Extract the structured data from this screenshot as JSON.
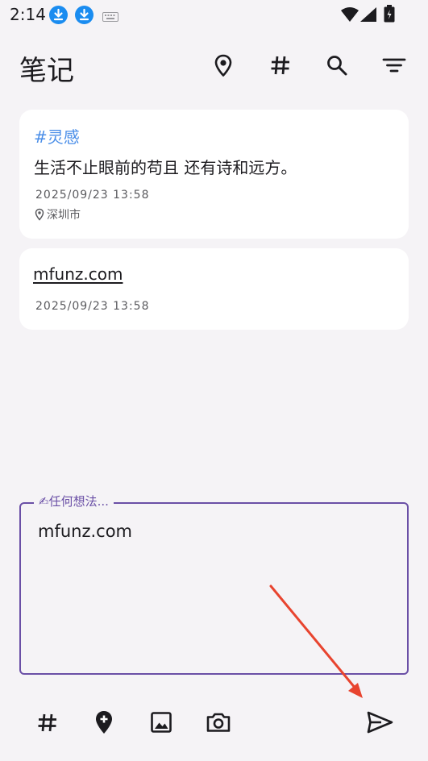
{
  "status_bar": {
    "time": "2:14",
    "icons": [
      "download-icon",
      "download-icon",
      "keyboard-icon",
      "wifi-icon",
      "signal-icon",
      "battery-icon"
    ]
  },
  "app_bar": {
    "title": "笔记",
    "actions": [
      "location-icon",
      "hashtag-icon",
      "search-icon",
      "filter-icon"
    ]
  },
  "notes": [
    {
      "tag": "#灵感",
      "text": "生活不止眼前的苟且 还有诗和远方。",
      "date": "2025/09/23 13:58",
      "location": "深圳市"
    },
    {
      "link": "mfunz.com",
      "date": "2025/09/23 13:58"
    }
  ],
  "composer": {
    "label": "✍任何想法...",
    "value": "mfunz.com"
  },
  "toolbar": {
    "actions": [
      "hashtag-icon",
      "add-location-icon",
      "image-icon",
      "camera-icon"
    ],
    "send": "send-icon"
  },
  "colors": {
    "accent": "#6a4fa6",
    "tag": "#4a8ee8",
    "annotation_arrow": "#e8442f",
    "background": "#f5f3f6"
  }
}
